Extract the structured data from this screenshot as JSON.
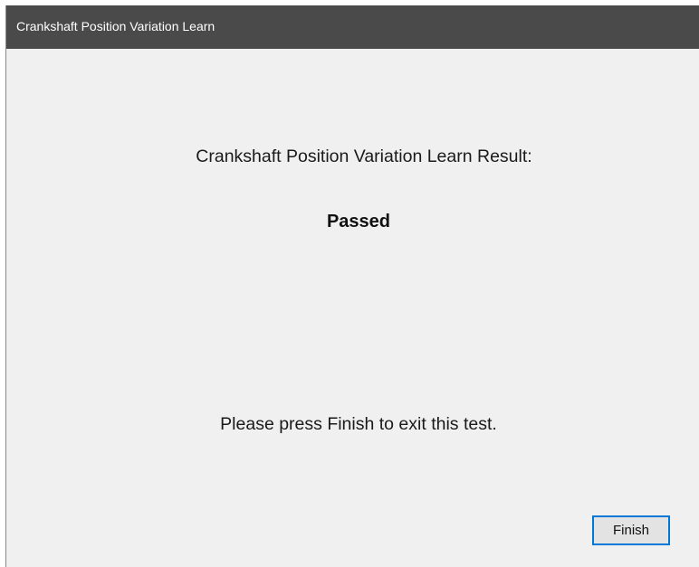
{
  "window": {
    "title": "Crankshaft Position Variation Learn"
  },
  "content": {
    "result_label": "Crankshaft Position Variation Learn Result:",
    "result_value": "Passed",
    "instruction": "Please press Finish to exit this test."
  },
  "buttons": {
    "finish_label": "Finish"
  },
  "colors": {
    "title_bar": "#4a4a4a",
    "window_background": "#f0f0f0",
    "button_focus_border": "#0078d7"
  }
}
